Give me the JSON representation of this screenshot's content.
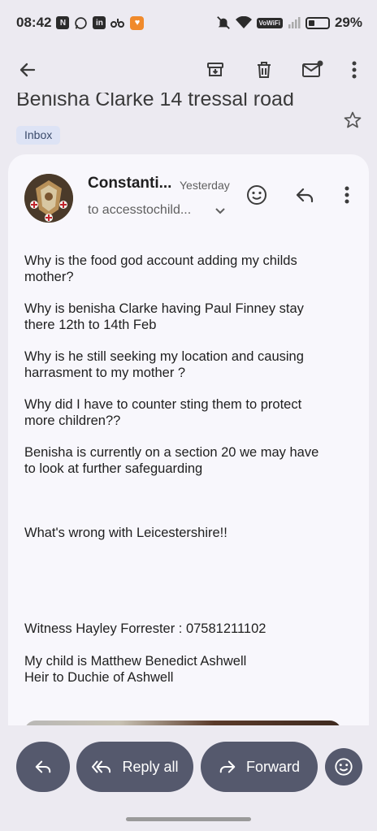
{
  "status_bar": {
    "time": "08:42",
    "battery": "29%",
    "wifi_badge": "VoWiFi",
    "notification_icons": [
      "n-icon",
      "whatsapp-icon",
      "linkedin-icon",
      "app-icon",
      "heart-icon"
    ]
  },
  "toolbar": {
    "icons": [
      "back-arrow-icon",
      "archive-icon",
      "delete-icon",
      "mark-unread-icon",
      "more-vert-icon"
    ]
  },
  "email": {
    "subject": "Benisha Clarke 14 tressal road",
    "label": "Inbox",
    "sender": "Constanti...",
    "time": "Yesterday",
    "recipient": "to accesstochild...",
    "paragraphs": [
      [
        "Why is the food god account adding my childs",
        "mother?"
      ],
      [
        "Why is benisha Clarke having Paul Finney stay",
        "there 12th to 14th Feb"
      ],
      [
        "Why is he still seeking my location and causing",
        "harrasment to my mother ?"
      ],
      [
        "Why did I have to counter sting them to protect",
        "more children??"
      ],
      [
        "Benisha is currently on a section 20 we may have",
        "to look at further safeguarding"
      ],
      [
        "What's wrong with Leicestershire!!"
      ],
      [
        "Witness Hayley Forrester : 07581211102"
      ],
      [
        "My child is Matthew Benedict Ashwell",
        "Heir to Duchie of Ashwell"
      ]
    ]
  },
  "actions": {
    "reply_all": "Reply all",
    "forward": "Forward"
  }
}
